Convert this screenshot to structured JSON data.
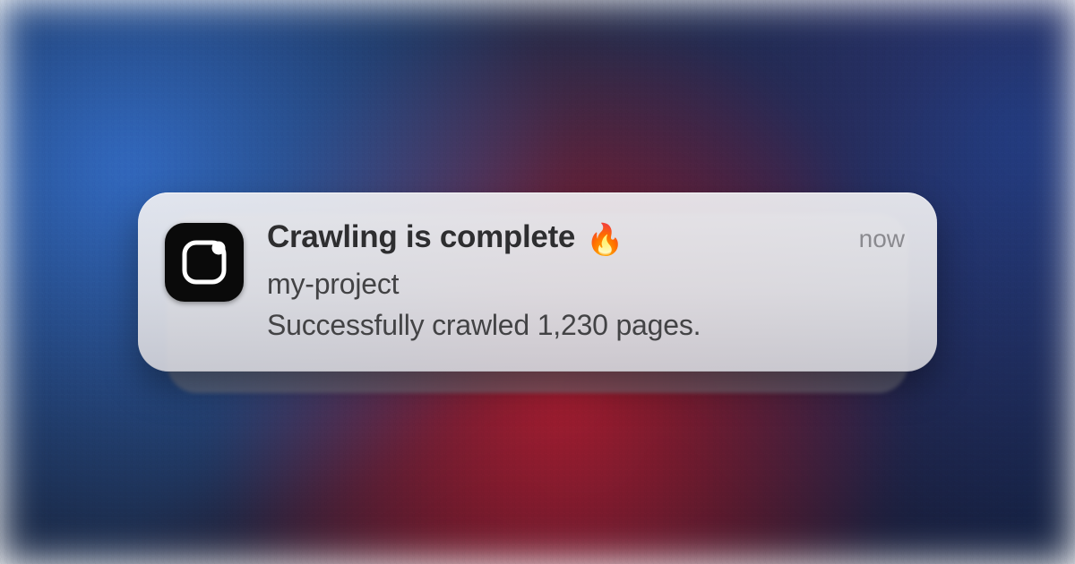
{
  "notification": {
    "title": "Crawling is complete",
    "emoji": "🔥",
    "subtitle": "my-project",
    "body": "Successfully crawled 1,230 pages.",
    "timestamp": "now",
    "app_icon": "app-badge-icon"
  }
}
